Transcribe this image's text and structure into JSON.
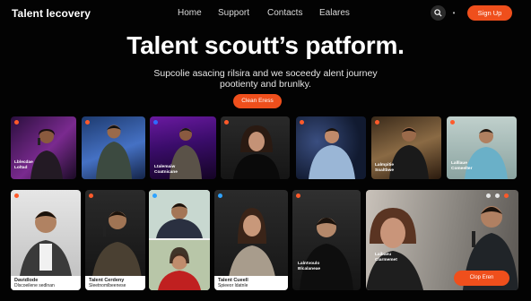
{
  "header": {
    "logo": "Talent lecovery",
    "nav": [
      "Home",
      "Support",
      "Contacts",
      "Ealares"
    ],
    "signup": "Sign Up"
  },
  "hero": {
    "title": "Talent scoutt’s patform.",
    "subtitle": "Supcolie asacing rilsira and we soceedy alent journey pootienty and brunlky.",
    "cta": "Clean Eress"
  },
  "cards_top": [
    {
      "tag": "Lblecdae\nLoltad",
      "accent": "#ff5a2a"
    },
    {
      "tag": "",
      "accent": "#ff5a2a"
    },
    {
      "tag": "Ltalemaiw\nCoatnicane",
      "accent": "#2f6bff"
    },
    {
      "tag": "",
      "accent": "#ff5a2a"
    },
    {
      "tag": "",
      "accent": "#ff5a2a"
    },
    {
      "tag": "Lalmpitie\nSoaltbwe",
      "accent": "#ff5a2a"
    },
    {
      "tag": "Lalllaue\nComeelter",
      "accent": "#ff5a2a"
    }
  ],
  "cards_bottom": [
    {
      "caption_title": "Davidlode",
      "caption_sub": "Dlscoeilene sedlnan",
      "accent": "#ff5a2a"
    },
    {
      "caption_title": "Talent Cerdeny",
      "caption_sub": "Sleetnomlbeenese",
      "accent": "#ff5a2a"
    },
    {
      "caption_title": "",
      "caption_sub": "",
      "accent": "#2fa3ff"
    },
    {
      "caption_title": "Talent Cueell",
      "caption_sub": "Spieeor ldatnle",
      "accent": "#2fa3ff"
    },
    {
      "caption_title": "Lalntvoulo",
      "caption_sub": "Blcalaneae",
      "accent": "#ff5a2a"
    },
    {
      "caption_title": "Laibaeu",
      "caption_sub": "Clarmemet",
      "accent": "#ff5a2a"
    }
  ],
  "feature_cta": "Clop Eren"
}
